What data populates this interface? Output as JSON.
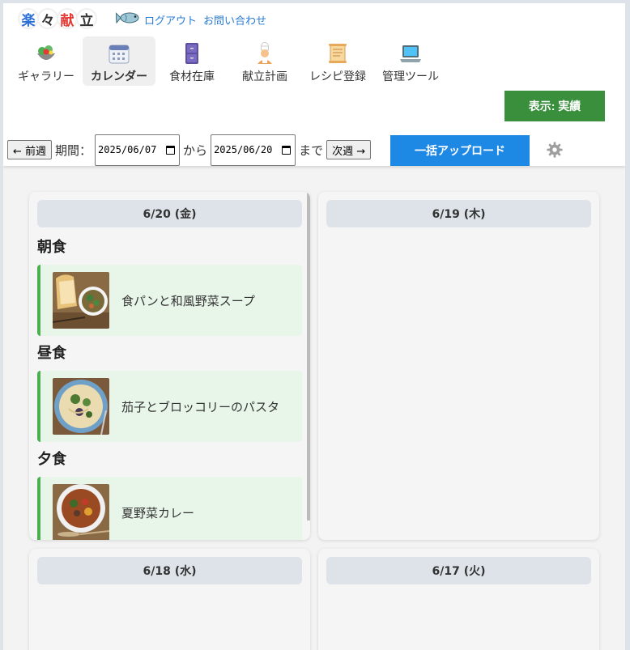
{
  "logo": {
    "chars": [
      "楽",
      "々",
      "献",
      "立"
    ],
    "colors": [
      "#2b6fd6",
      "#333333",
      "#e53935",
      "#333333"
    ]
  },
  "toplinks": {
    "logout": "ログアウト",
    "contact": "お問い合わせ"
  },
  "nav": [
    {
      "label": "ギャラリー",
      "icon": "salad-icon"
    },
    {
      "label": "カレンダー",
      "icon": "calendar-icon",
      "active": true
    },
    {
      "label": "食材在庫",
      "icon": "cabinet-icon"
    },
    {
      "label": "献立計画",
      "icon": "chef-icon"
    },
    {
      "label": "レシピ登録",
      "icon": "scroll-icon"
    },
    {
      "label": "管理ツール",
      "icon": "laptop-icon"
    }
  ],
  "display_toggle": "表示: 実績",
  "controls": {
    "prev": "← 前週",
    "period_label": "期間：",
    "start_date": "2025/06/07",
    "from": "から",
    "end_date": "2025/06/20",
    "until": "まで",
    "next": "次週 →",
    "bulk_upload": "一括アップロード"
  },
  "days": [
    {
      "date": "6/20 (金)",
      "meals": [
        {
          "type": "朝食",
          "dish": "食パンと和風野菜スープ"
        },
        {
          "type": "昼食",
          "dish": "茄子とブロッコリーのパスタ"
        },
        {
          "type": "夕食",
          "dish": "夏野菜カレー"
        }
      ]
    },
    {
      "date": "6/19 (木)",
      "meals": []
    },
    {
      "date": "6/18 (水)",
      "meals": []
    },
    {
      "date": "6/17 (火)",
      "meals": []
    }
  ],
  "colors": {
    "accent_green": "#3a8f3d",
    "upload_blue": "#1e88e5",
    "meal_bg": "#e8f6ea",
    "meal_border": "#4caf50"
  }
}
